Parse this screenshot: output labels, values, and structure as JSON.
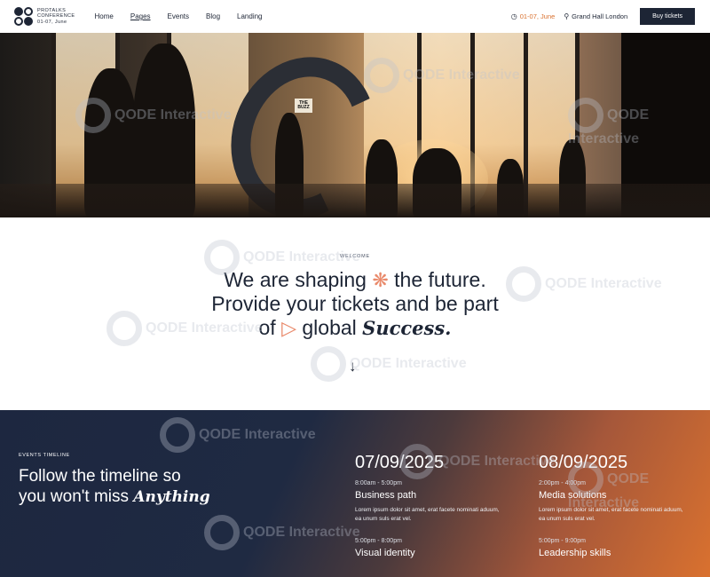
{
  "header": {
    "logo_line1": "PROTALKS",
    "logo_line2": "CONFERENCE",
    "logo_line3": "01-07, June",
    "nav": [
      "Home",
      "Pages",
      "Events",
      "Blog",
      "Landing"
    ],
    "active_nav": "Pages",
    "date_label": "01-07, June",
    "location_label": "Grand Hall London",
    "buy_label": "Buy tickets"
  },
  "hero": {
    "sign_text": "THE BUZZ"
  },
  "welcome": {
    "eyebrow": "WELCOME",
    "line1_a": "We are shaping",
    "line1_b": "the future.",
    "line2": "Provide your tickets and be part",
    "line3_a": "of",
    "line3_b": "global",
    "line3_c": "Success."
  },
  "timeline": {
    "eyebrow": "EVENTS TIMELINE",
    "title_line1": "Follow the timeline so",
    "title_line2_a": "you won't miss",
    "title_line2_b": "Anything",
    "days": [
      {
        "date": "07/09/2025",
        "sessions": [
          {
            "time": "8:00am - 5:00pm",
            "title": "Business path",
            "text": "Lorem ipsum dolor sit amet, erat facete nominati aduum, ea unum suls erat vel."
          },
          {
            "time": "5:00pm - 8:00pm",
            "title": "Visual identity",
            "text": ""
          }
        ]
      },
      {
        "date": "08/09/2025",
        "sessions": [
          {
            "time": "2:00pm - 4:00pm",
            "title": "Media solutions",
            "text": "Lorem ipsum dolor sit amet, erat facete nominati aduum, ea unum suls erat vel."
          },
          {
            "time": "5:00pm - 9:00pm",
            "title": "Leadership skills",
            "text": ""
          }
        ]
      }
    ]
  },
  "watermark": "QODE Interactive",
  "colors": {
    "navy": "#1d2535",
    "accent_orange": "#d9712f",
    "deco_pink": "#e9896a"
  },
  "icons": [
    "clock-icon",
    "location-pin-icon",
    "asterisk-deco-icon",
    "play-deco-icon",
    "arrow-down-icon"
  ]
}
